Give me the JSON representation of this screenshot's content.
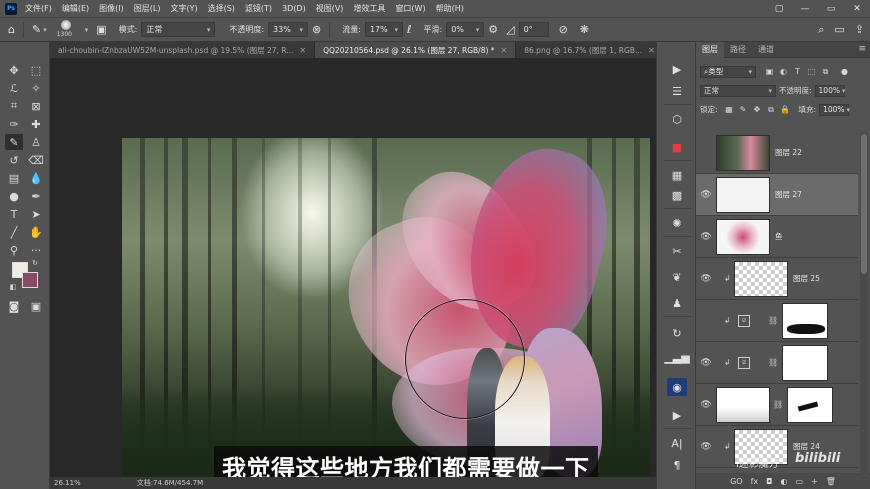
{
  "menubar": {
    "logo": "Ps",
    "items": [
      "文件(F)",
      "编辑(E)",
      "图像(I)",
      "图层(L)",
      "文字(Y)",
      "选择(S)",
      "滤镜(T)",
      "3D(D)",
      "视图(V)",
      "增效工具",
      "窗口(W)",
      "帮助(H)"
    ],
    "window_controls": [
      "▢",
      "—",
      "▭",
      "✕"
    ]
  },
  "options": {
    "brush_size": "1300",
    "mode_label": "模式:",
    "mode_value": "正常",
    "opacity_label": "不透明度:",
    "opacity_value": "33%",
    "flow_label": "流量:",
    "flow_value": "17%",
    "smoothing_label": "平滑:",
    "smoothing_value": "0%",
    "angle_value": "0°"
  },
  "tabs": [
    {
      "label": "ali-choubin-lZnbzaUW52M-unsplash.psd @ 19.5% (图层 27, R...",
      "close": "✕"
    },
    {
      "label": "QQ20210564.psd @ 26.1% (图层 27, RGB/8) *",
      "close": "✕"
    },
    {
      "label": "86.png @ 16.7% (图层 1, RGB...",
      "close": "✕"
    }
  ],
  "subtitle": "我觉得这些地方我们都需要做一下",
  "status": {
    "zoom": "26.11%",
    "doc": "文档:74.6M/454.7M"
  },
  "layers_panel": {
    "tabs": [
      "图层",
      "路径",
      "通道"
    ],
    "filter_label": "类型",
    "blend_mode": "正常",
    "opacity_label": "不透明度:",
    "opacity_value": "100%",
    "lock_label": "锁定:",
    "fill_label": "填充:",
    "fill_value": "100%",
    "layers": [
      {
        "name": "图层 22"
      },
      {
        "name": "图层 27"
      },
      {
        "name": "鱼"
      },
      {
        "name": "图层 25"
      },
      {
        "name": ""
      },
      {
        "name": ""
      },
      {
        "name": ""
      },
      {
        "name": "图层 24"
      }
    ],
    "bottom_icons": [
      "GO",
      "fx",
      "◘",
      "◐",
      "▭",
      "+",
      "🗑"
    ]
  },
  "watermark": "bilibili",
  "watermark_prefix": "i迷影魔方"
}
